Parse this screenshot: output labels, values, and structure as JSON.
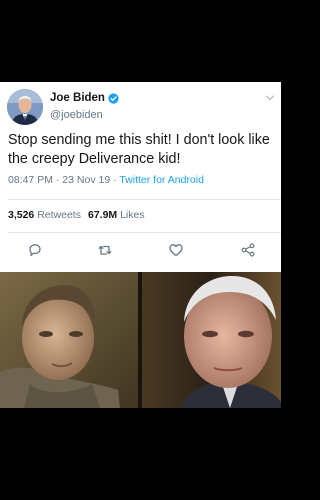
{
  "tweet": {
    "display_name": "Joe Biden",
    "handle": "@joebiden",
    "text": "Stop sending me this shit! I don't look like the creepy Deliverance kid!",
    "time": "08:47 PM",
    "date": "23 Nov 19",
    "separator": "·",
    "source": "Twitter for Android",
    "retweets_count": "3,526",
    "retweets_label": "Retweets",
    "likes_count": "67.9M",
    "likes_label": "Likes"
  },
  "icons": {
    "verified": "verified-badge-icon",
    "menu": "chevron-down-icon",
    "reply": "reply-icon",
    "retweet": "retweet-icon",
    "like": "heart-icon",
    "share": "share-icon"
  },
  "colors": {
    "background": "#000000",
    "card": "#ffffff",
    "text": "#14171a",
    "muted": "#657786",
    "link": "#1da1f2",
    "verified": "#1da1f2"
  }
}
